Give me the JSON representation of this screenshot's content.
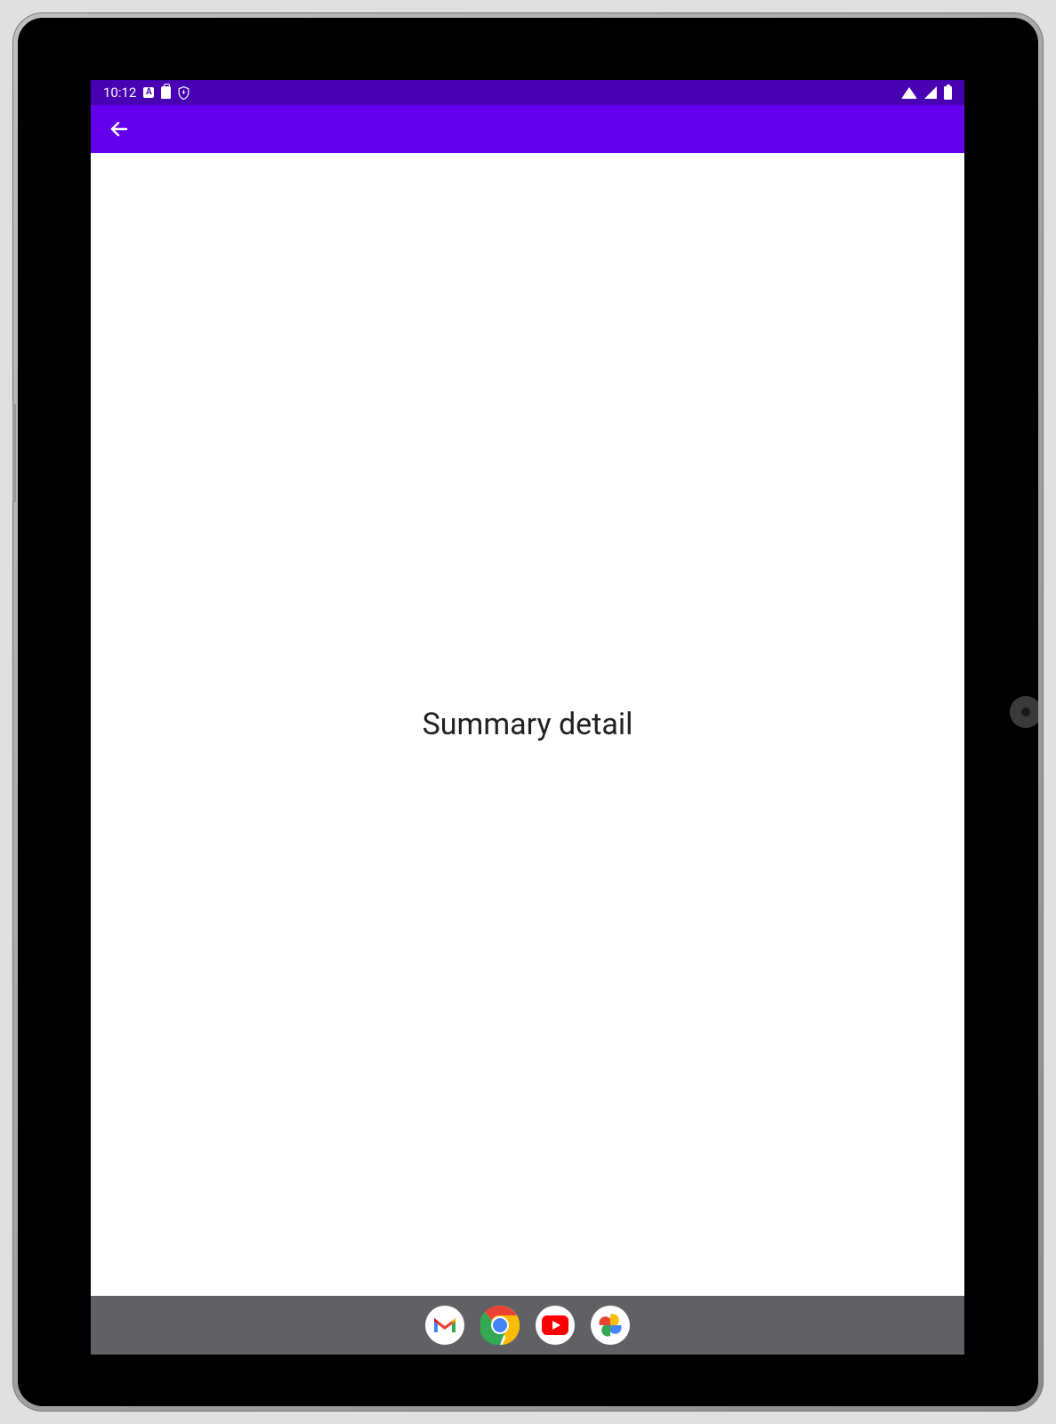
{
  "status_bar": {
    "time": "10:12",
    "indicators": {
      "keyboard": "A",
      "clipboard": true,
      "vpn_shield": true,
      "wifi": true,
      "cellular": "partial",
      "battery": "full"
    }
  },
  "app_bar": {
    "back_icon": "arrow-back"
  },
  "content": {
    "title": "Summary detail"
  },
  "taskbar": {
    "apps": [
      {
        "name": "Gmail",
        "icon": "gmail-icon"
      },
      {
        "name": "Chrome",
        "icon": "chrome-icon"
      },
      {
        "name": "YouTube",
        "icon": "youtube-icon"
      },
      {
        "name": "Photos",
        "icon": "photos-icon"
      }
    ]
  },
  "colors": {
    "status_bar_bg": "#4800b3",
    "app_bar_bg": "#6200EE",
    "taskbar_bg": "#5f6165",
    "content_bg": "#ffffff"
  }
}
